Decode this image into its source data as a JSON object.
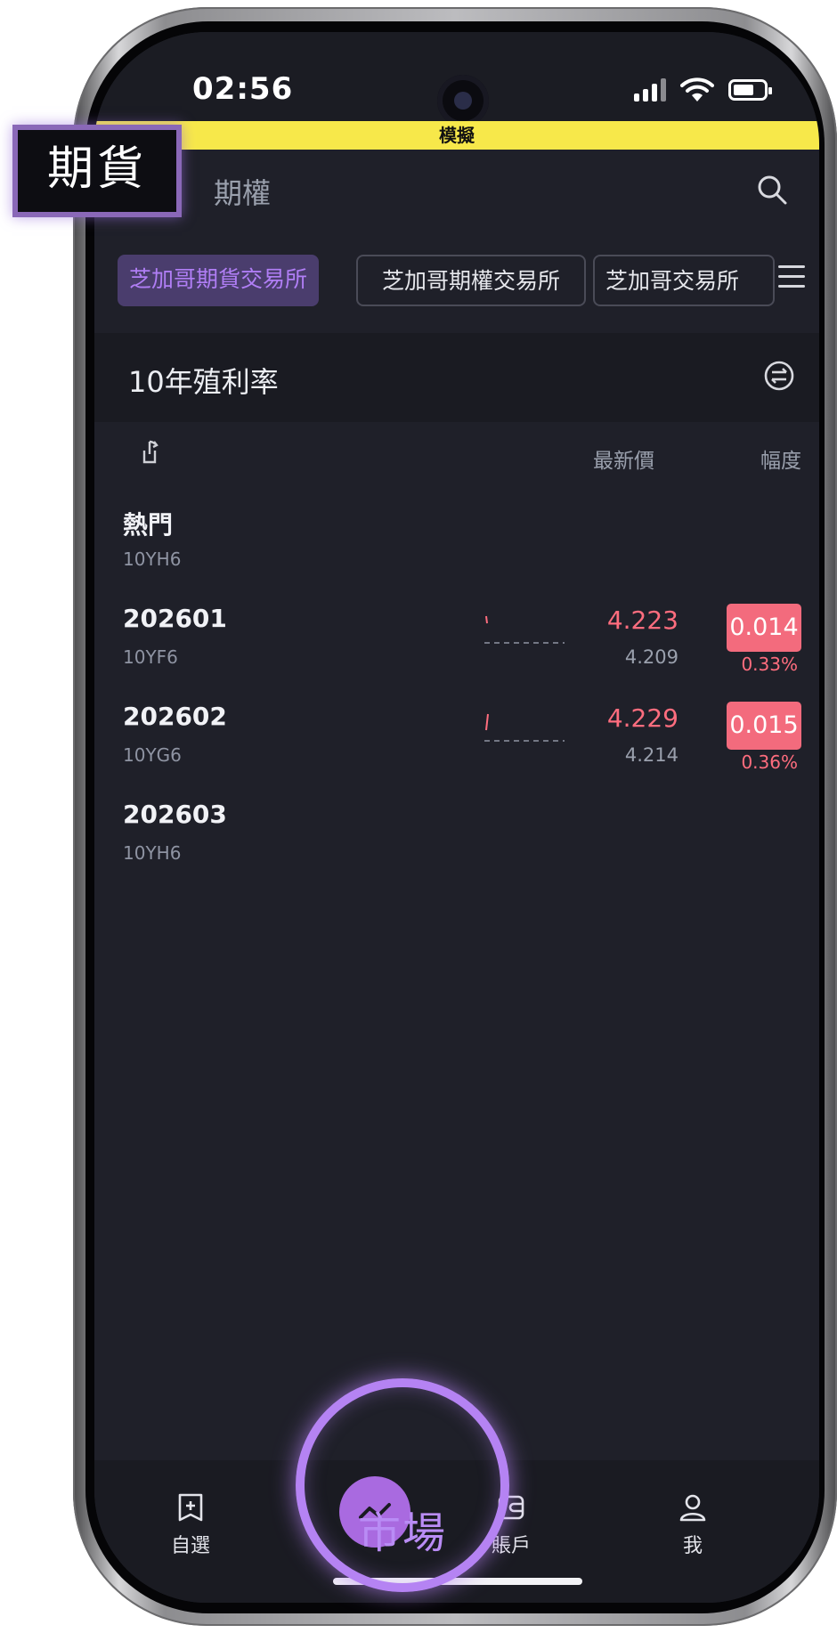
{
  "status_bar": {
    "time": "02:56"
  },
  "banner": {
    "label": "模擬"
  },
  "top_tabs": {
    "futures": "期貨",
    "options": "期權"
  },
  "exchanges": {
    "items": [
      {
        "label": "芝加哥期貨交易所",
        "active": true
      },
      {
        "label": "芝加哥期權交易所",
        "active": false
      },
      {
        "label": "芝加哥交易所",
        "active": false
      }
    ]
  },
  "section": {
    "title": "10年殖利率"
  },
  "columns": {
    "latest": "最新價",
    "change": "幅度"
  },
  "rows": [
    {
      "name": "熱門",
      "code": "10YH6"
    },
    {
      "name": "202601",
      "code": "10YF6",
      "price": "4.223",
      "prev": "4.209",
      "change": "0.014",
      "pct": "0.33%"
    },
    {
      "name": "202602",
      "code": "10YG6",
      "price": "4.229",
      "prev": "4.214",
      "change": "0.015",
      "pct": "0.36%"
    },
    {
      "name": "202603",
      "code": "10YH6"
    }
  ],
  "bottom_nav": {
    "watchlist": "自選",
    "market": "市場",
    "account": "賬戶",
    "me": "我"
  },
  "colors": {
    "accent": "#b583f3",
    "up": "#ff6d7e",
    "banner": "#f7e84a",
    "background": "#1f2029"
  },
  "icons": [
    "search-icon",
    "menu-icon",
    "swap-icon",
    "share-icon",
    "add-watchlist-icon",
    "market-trend-icon",
    "wallet-icon",
    "user-icon"
  ]
}
